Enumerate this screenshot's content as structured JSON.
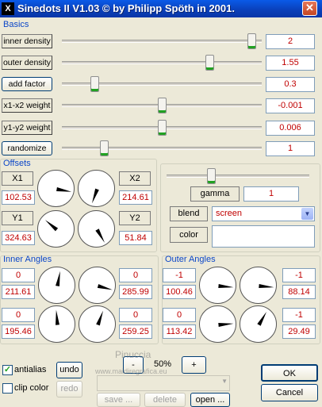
{
  "window": {
    "title": "Sinedots II V1.03 © by Philipp Spöth in 2001.",
    "icon_glyph": "X",
    "close_glyph": "✕"
  },
  "basics": {
    "label": "Basics",
    "params": [
      {
        "label": "inner density",
        "value": "2",
        "level": 0.97
      },
      {
        "label": "outer density",
        "value": "1.55",
        "level": 0.75
      },
      {
        "label": "add factor",
        "value": "0.3",
        "level": 0.15
      },
      {
        "label": "x1-x2 weight",
        "value": "-0.001",
        "level": 0.5
      },
      {
        "label": "y1-y2 weight",
        "value": "0.006",
        "level": 0.5
      },
      {
        "label": "randomize",
        "value": "1",
        "level": 0.2
      }
    ]
  },
  "offsets": {
    "label": "Offsets",
    "x1_label": "X1",
    "x1_value": "102.53",
    "x2_label": "X2",
    "x2_value": "214.61",
    "y1_label": "Y1",
    "y1_value": "324.63",
    "y2_label": "Y2",
    "y2_value": "51.84"
  },
  "right_panel": {
    "gamma_label": "gamma",
    "gamma_value": "1",
    "gamma_level": 0.3,
    "blend_label": "blend",
    "blend_value": "screen",
    "select_arrow": "▼",
    "color_label": "color"
  },
  "inner_angles": {
    "label": "Inner Angles",
    "tl": "0",
    "bl": "211.61",
    "tr": "0",
    "br": "285.99",
    "tl2": "0",
    "bl2": "195.46",
    "tr2": "0",
    "br2": "259.25"
  },
  "outer_angles": {
    "label": "Outer Angles",
    "tl": "-1",
    "bl": "100.46",
    "tr": "-1",
    "br": "88.14",
    "tl2": "0",
    "bl2": "113.42",
    "tr2": "-1",
    "br2": "29.49"
  },
  "bottom": {
    "antialias_label": "antialias",
    "antialias_checked": true,
    "clip_color_label": "clip color",
    "clip_color_checked": false,
    "undo_label": "undo",
    "redo_label": "redo",
    "zoom_minus": "-",
    "zoom_value": "50%",
    "zoom_plus": "+",
    "save_label": "save ...",
    "delete_label": "delete",
    "open_label": "open ...",
    "ok_label": "OK",
    "cancel_label": "Cancel",
    "check_glyph": "✓"
  },
  "watermark": {
    "line1": "Pinuccia",
    "line2": "www.maidiregrafica.eu"
  }
}
